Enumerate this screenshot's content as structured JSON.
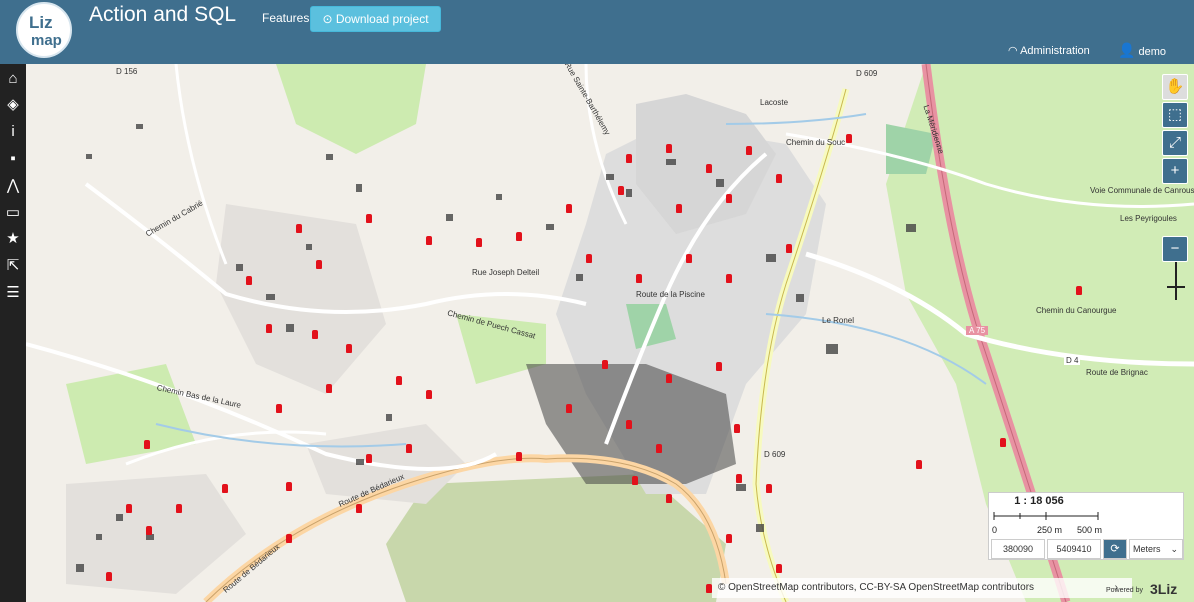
{
  "header": {
    "logo_top": "Liz",
    "logo_bottom": "map",
    "title": "Action and SQL",
    "features_label": "Features",
    "download_label": "Download project",
    "admin_label": "Administration",
    "user_label": "demo"
  },
  "sidebar": {
    "items": [
      {
        "icon": "home-icon",
        "glyph": "⌂"
      },
      {
        "icon": "layers-icon",
        "glyph": "◈"
      },
      {
        "icon": "info-icon",
        "glyph": "i"
      },
      {
        "icon": "comment-icon",
        "glyph": "▪"
      },
      {
        "icon": "elevation-icon",
        "glyph": "⋀"
      },
      {
        "icon": "presentation-icon",
        "glyph": "▭"
      },
      {
        "icon": "star-icon",
        "glyph": "★"
      },
      {
        "icon": "share-icon",
        "glyph": "⇱"
      },
      {
        "icon": "list-icon",
        "glyph": "☰"
      }
    ]
  },
  "map": {
    "labels": [
      "D 156",
      "D 609",
      "La Méridienne",
      "Chemin du Cabrié",
      "Rue Joseph Delteil",
      "Route de la Piscine",
      "Chemin de Puech Cassat",
      "Le Ronel",
      "Route de Brignac",
      "Les Peyrigoules",
      "Chemin du Canourgue",
      "A 75",
      "D 4",
      "Route de Bédarieux",
      "Chemin Bas de la Laure",
      "Lacoste",
      "Chemin du Souc",
      "Rue Sainte-Barthélemy",
      "Voie Communale de Canrous",
      "D 609",
      "Route de Bédarieux"
    ],
    "scale_label": "1 : 18 056",
    "scale_ticks": [
      "0",
      "250 m",
      "500 m"
    ],
    "coord_x": "380090",
    "coord_y": "5409410",
    "units": "Meters",
    "attribution": "© OpenStreetMap contributors, CC-BY-SA OpenStreetMap contributors",
    "attribution_arrow": "›",
    "powered_by": "Powered by",
    "powered_brand": "3Liz"
  }
}
